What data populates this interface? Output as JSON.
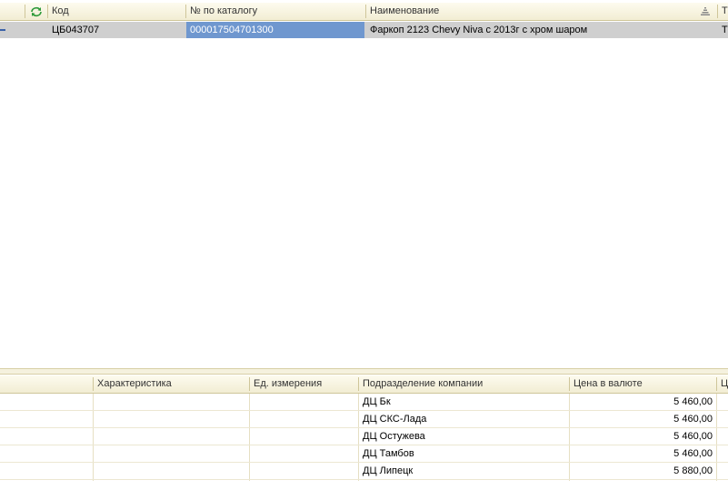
{
  "top_grid": {
    "headers": {
      "code": "Код",
      "catalog_no": "№ по каталогу",
      "name": "Наименование",
      "next": "Т"
    },
    "row": {
      "code": "ЦБ043707",
      "catalog_no": "000017504701300",
      "name": "Фаркоп 2123 Chevy Niva с 2013г с хром шаром",
      "next": "Т"
    }
  },
  "bottom_grid": {
    "headers": {
      "characteristic": "Характеристика",
      "unit": "Ед. измерения",
      "department": "Подразделение компании",
      "price_currency": "Цена в валюте",
      "next": "Ц"
    },
    "rows": [
      {
        "department": "ДЦ Бк",
        "price": "5 460,00"
      },
      {
        "department": "ДЦ СКС-Лада",
        "price": "5 460,00"
      },
      {
        "department": "ДЦ Остужева",
        "price": "5 460,00"
      },
      {
        "department": "ДЦ Тамбов",
        "price": "5 460,00"
      },
      {
        "department": "ДЦ Липецк",
        "price": "5 880,00"
      }
    ]
  },
  "colors": {
    "selection": "#6f97cf",
    "row_highlight": "#cfcfcf",
    "header_bg": "#f2edd3",
    "refresh_icon": "#2e9a3a"
  }
}
